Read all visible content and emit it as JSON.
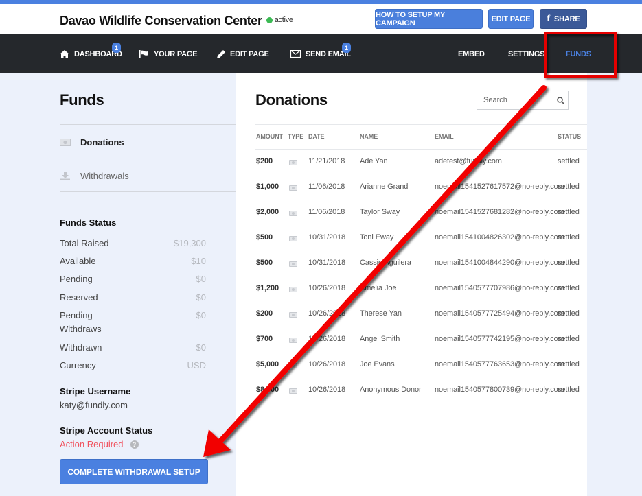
{
  "header": {
    "title": "Davao Wildlife Conservation Center",
    "status": "active",
    "buttons": {
      "how_to": "HOW TO SETUP MY CAMPAIGN",
      "edit_page": "EDIT PAGE",
      "share": "SHARE"
    }
  },
  "nav": {
    "items": [
      {
        "label": "DASHBOARD",
        "icon": "home-icon",
        "badge": "1"
      },
      {
        "label": "YOUR PAGE",
        "icon": "flag-icon"
      },
      {
        "label": "EDIT PAGE",
        "icon": "pencil-icon"
      },
      {
        "label": "SEND EMAIL",
        "icon": "envelope-icon",
        "badge": "1"
      },
      {
        "label": "EMBED"
      },
      {
        "label": "SETTINGS"
      },
      {
        "label": "FUNDS",
        "active": true
      }
    ]
  },
  "sidebar": {
    "title": "Funds",
    "items": [
      {
        "label": "Donations",
        "icon": "money-icon",
        "active": true
      },
      {
        "label": "Withdrawals",
        "icon": "download-icon"
      }
    ],
    "funds_status": {
      "title": "Funds Status",
      "rows": [
        {
          "label": "Total Raised",
          "value": "$19,300"
        },
        {
          "label": "Available",
          "value": "$10"
        },
        {
          "label": "Pending",
          "value": "$0"
        },
        {
          "label": "Reserved",
          "value": "$0"
        },
        {
          "label": "Pending Withdraws",
          "value": "$0"
        },
        {
          "label": "Withdrawn",
          "value": "$0"
        },
        {
          "label": "Currency",
          "value": "USD"
        }
      ]
    },
    "stripe_username_label": "Stripe Username",
    "stripe_username": "katy@fundly.com",
    "stripe_status_label": "Stripe Account Status",
    "stripe_status": "Action Required",
    "complete_button": "COMPLETE WITHDRAWAL SETUP"
  },
  "main": {
    "title": "Donations",
    "search_placeholder": "Search",
    "columns": [
      "AMOUNT",
      "TYPE",
      "DATE",
      "NAME",
      "EMAIL",
      "STATUS"
    ],
    "rows": [
      {
        "amount": "$200",
        "date": "11/21/2018",
        "name": "Ade Yan",
        "email": "adetest@fundly.com",
        "status": "settled"
      },
      {
        "amount": "$1,000",
        "date": "11/06/2018",
        "name": "Arianne Grand",
        "email": "noemail1541527617572@no-reply.com",
        "status": "settled"
      },
      {
        "amount": "$2,000",
        "date": "11/06/2018",
        "name": "Taylor Sway",
        "email": "noemail1541527681282@no-reply.com",
        "status": "settled"
      },
      {
        "amount": "$500",
        "date": "10/31/2018",
        "name": "Toni Eway",
        "email": "noemail1541004826302@no-reply.com",
        "status": "settled"
      },
      {
        "amount": "$500",
        "date": "10/31/2018",
        "name": "Cassie Aguilera",
        "email": "noemail1541004844290@no-reply.com",
        "status": "settled"
      },
      {
        "amount": "$1,200",
        "date": "10/26/2018",
        "name": "Amelia Joe",
        "email": "noemail1540577707986@no-reply.com",
        "status": "settled"
      },
      {
        "amount": "$200",
        "date": "10/26/2018",
        "name": "Therese Yan",
        "email": "noemail1540577725494@no-reply.com",
        "status": "settled"
      },
      {
        "amount": "$700",
        "date": "10/26/2018",
        "name": "Angel Smith",
        "email": "noemail1540577742195@no-reply.com",
        "status": "settled"
      },
      {
        "amount": "$5,000",
        "date": "10/26/2018",
        "name": "Joe Evans",
        "email": "noemail1540577763653@no-reply.com",
        "status": "settled"
      },
      {
        "amount": "$8,000",
        "date": "10/26/2018",
        "name": "Anonymous Donor",
        "email": "noemail1540577800739@no-reply.com",
        "status": "settled"
      }
    ]
  },
  "annotation": {
    "highlight_color": "#e60000",
    "arrow_color": "#f20000"
  }
}
